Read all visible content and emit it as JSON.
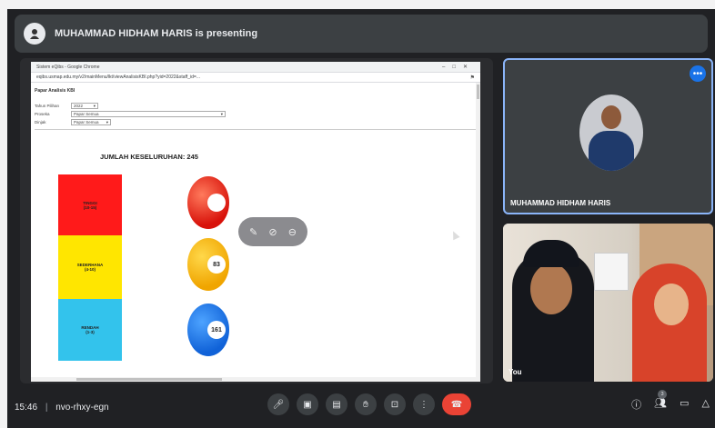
{
  "banner": {
    "presenting_text": "MUHAMMAD HIDHAM HARIS is presenting"
  },
  "browser": {
    "window_title": "Sistem eQibs - Google Chrome",
    "url": "eqibs.usmap.edu.my/v2/mainMenu/lkt/viewAnalisisKBI.php?yid=2022&staff_id=...",
    "page_title": "Papar Analisis KBI",
    "filters": [
      {
        "label": "Tahun Pilihan",
        "value": "2022"
      },
      {
        "label": "Proseka",
        "value": "Papar Semua"
      },
      {
        "label": "Dinjak",
        "value": "Papar Semua"
      }
    ],
    "total_label": "JUMLAH KESELURUHAN: 245",
    "categories": [
      {
        "name": "TINGGI",
        "range": "(10-15)",
        "count": ""
      },
      {
        "name": "SEDERHANA",
        "range": "(4-10)",
        "count": "83"
      },
      {
        "name": "RENDAH",
        "range": "(1-3)",
        "count": "161"
      }
    ]
  },
  "participants": {
    "main_name": "MUHAMMAD HIDHAM HARIS",
    "self_label": "You"
  },
  "footer": {
    "time": "15:46",
    "meeting_code": "nvo-rhxy-egn",
    "people_count": "3"
  },
  "colors": {
    "hangup": "#ea4335",
    "accent": "#1a73e8"
  }
}
